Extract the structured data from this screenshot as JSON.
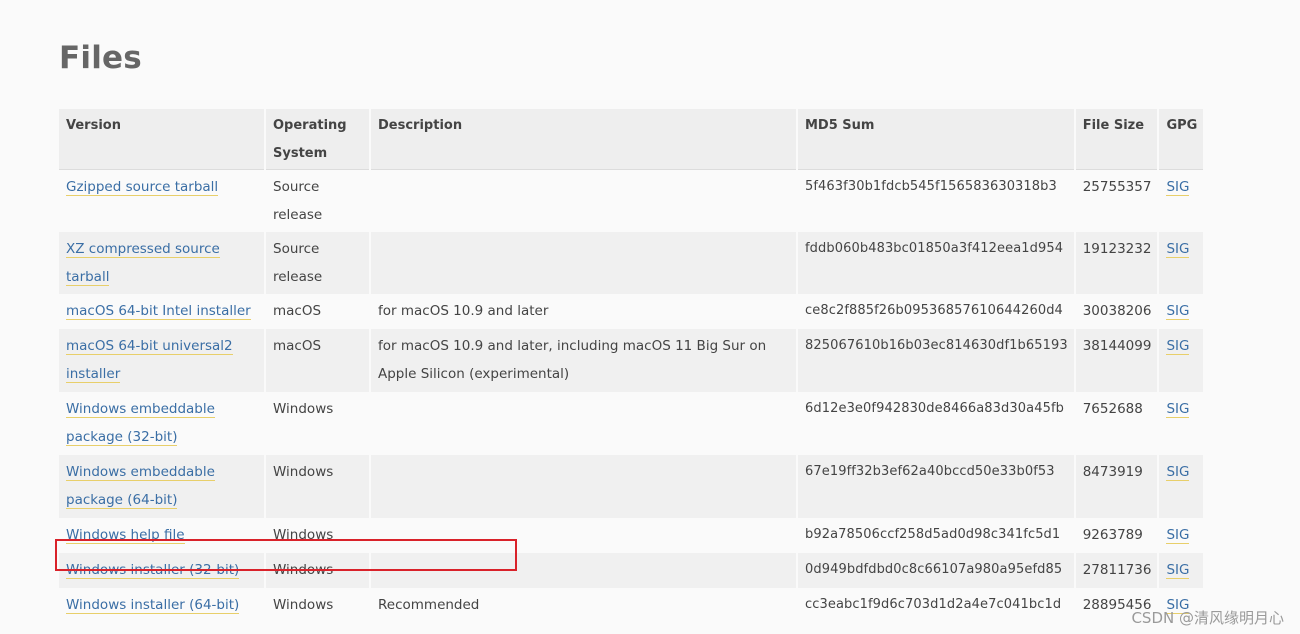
{
  "page": {
    "title": "Files"
  },
  "table": {
    "headers": {
      "version": "Version",
      "os": "Operating System",
      "description": "Description",
      "md5": "MD5 Sum",
      "size": "File Size",
      "gpg": "GPG"
    },
    "rows": [
      {
        "version": "Gzipped source tarball",
        "os": "Source release",
        "description": "",
        "md5": "5f463f30b1fdcb545f156583630318b3",
        "size": "25755357",
        "gpg": "SIG"
      },
      {
        "version": "XZ compressed source tarball",
        "os": "Source release",
        "description": "",
        "md5": "fddb060b483bc01850a3f412eea1d954",
        "size": "19123232",
        "gpg": "SIG"
      },
      {
        "version": "macOS 64-bit Intel installer",
        "os": "macOS",
        "description": "for macOS 10.9 and later",
        "md5": "ce8c2f885f26b09536857610644260d4",
        "size": "30038206",
        "gpg": "SIG"
      },
      {
        "version": "macOS 64-bit universal2 installer",
        "os": "macOS",
        "description": "for macOS 10.9 and later, including macOS 11 Big Sur on Apple Silicon (experimental)",
        "md5": "825067610b16b03ec814630df1b65193",
        "size": "38144099",
        "gpg": "SIG"
      },
      {
        "version": "Windows embeddable package (32-bit)",
        "os": "Windows",
        "description": "",
        "md5": "6d12e3e0f942830de8466a83d30a45fb",
        "size": "7652688",
        "gpg": "SIG"
      },
      {
        "version": "Windows embeddable package (64-bit)",
        "os": "Windows",
        "description": "",
        "md5": "67e19ff32b3ef62a40bccd50e33b0f53",
        "size": "8473919",
        "gpg": "SIG"
      },
      {
        "version": "Windows help file",
        "os": "Windows",
        "description": "",
        "md5": "b92a78506ccf258d5ad0d98c341fc5d1",
        "size": "9263789",
        "gpg": "SIG"
      },
      {
        "version": "Windows installer (32-bit)",
        "os": "Windows",
        "description": "",
        "md5": "0d949bdfdbd0c8c66107a980a95efd85",
        "size": "27811736",
        "gpg": "SIG"
      },
      {
        "version": "Windows installer (64-bit)",
        "os": "Windows",
        "description": "Recommended",
        "md5": "cc3eabc1f9d6c703d1d2a4e7c041bc1d",
        "size": "28895456",
        "gpg": "SIG"
      }
    ]
  },
  "watermark": {
    "text": "CSDN @清风缘明月心"
  },
  "colors": {
    "link": "#3a6ea5",
    "link_underline": "#e8cf6a",
    "highlight": "#d9222a",
    "header_bg": "#eeeeee"
  }
}
